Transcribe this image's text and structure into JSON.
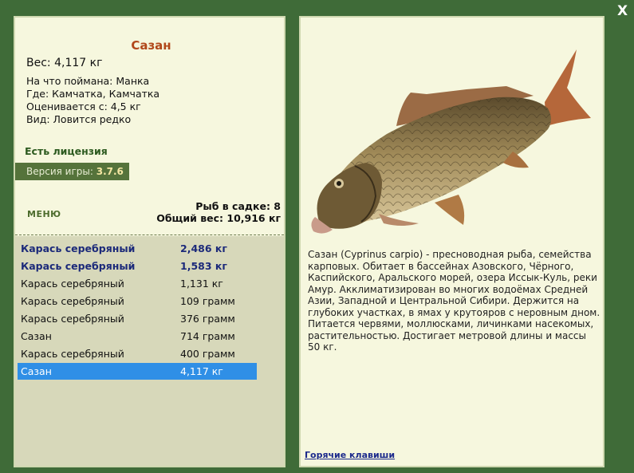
{
  "window": {
    "close_label": "X"
  },
  "fish": {
    "name": "Сазан",
    "weight": "Вес: 4,117 кг",
    "bait": "На что поймана: Манка",
    "place": "Где: Камчатка, Камчатка",
    "value": "Оценивается с: 4,5 кг",
    "rarity": "Вид: Ловится редко"
  },
  "license": "Есть лицензия",
  "version": {
    "label": "Версия игры: ",
    "number": "3.7.6"
  },
  "menu_label": "МЕНЮ",
  "keepnet": {
    "count": "Рыб в садке: 8",
    "total": "Общий вес: 10,916 кг"
  },
  "catch_list": [
    {
      "name": "Карась серебряный",
      "weight": "2,486 кг"
    },
    {
      "name": "Карась серебряный",
      "weight": "1,583 кг"
    },
    {
      "name": "Карась серебряный",
      "weight": "1,131 кг"
    },
    {
      "name": "Карась серебряный",
      "weight": "109 грамм"
    },
    {
      "name": "Карась серебряный",
      "weight": "376 грамм"
    },
    {
      "name": "Сазан",
      "weight": "714 грамм"
    },
    {
      "name": "Карась серебряный",
      "weight": "400 грамм"
    },
    {
      "name": "Сазан",
      "weight": "4,117 кг"
    }
  ],
  "description": "Сазан (Cyprinus carpio) - пресноводная рыба, семейства карповых. Обитает в бассейнах Азовского, Чёрного, Каспийского, Аральского морей, озера Иссык-Куль, реки Амур. Акклиматизирован во многих водоёмах Средней Азии, Западной и Центральной Сибири. Держится на глубоких участках, в ямах у крутояров с неровным дном. Питается червями, моллюсками, личинками насекомых, растительностью. Достигает метровой длины и массы 50 кг.",
  "hotkeys_label": "Горячие клавиши",
  "colors": {
    "frame": "#3f6b38",
    "panel": "#f6f7de",
    "title": "#b1471a",
    "selected": "#2f8fe6",
    "link": "#1c2a8c"
  }
}
